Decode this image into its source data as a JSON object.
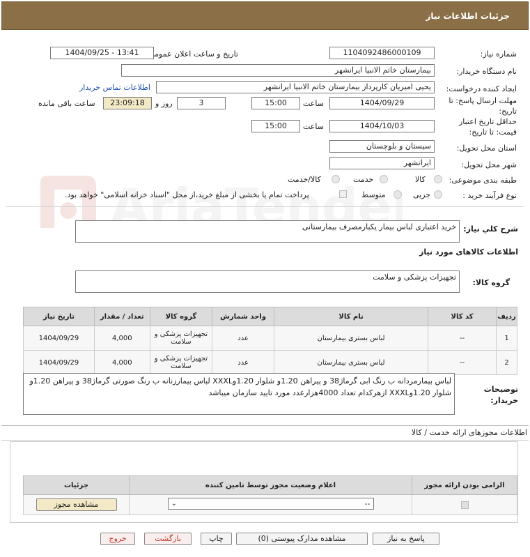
{
  "header": {
    "title": "جزئیات اطلاعات نیاز"
  },
  "fields": {
    "need_number_label": "شماره نیاز:",
    "need_number": "1104092486000109",
    "announce_label": "تاریخ و ساعت اعلان عمومی:",
    "announce_value": "1404/09/25 - 13:41",
    "buyer_label": "نام دستگاه خریدار:",
    "buyer_value": "بیمارستان خاتم الانبیا ایرانشهر",
    "creator_label": "ایجاد کننده درخواست:",
    "creator_value": "یحیی امیریان کارپرداز بیمارستان خاتم الانبیا ایرانشهر",
    "contact_link": "اطلاعات تماس خریدار",
    "deadline_label": "مهلت ارسال پاسخ: تا تاریخ:",
    "deadline_date": "1404/09/29",
    "time_label": "ساعت",
    "deadline_time": "15:00",
    "days_value": "3",
    "days_label": "روز و",
    "remaining_value": "23:09:18",
    "remaining_label": "ساعت باقی مانده",
    "validity_label": "حداقل تاریخ اعتبار قیمت: تا تاریخ:",
    "validity_date": "1404/10/03",
    "validity_time": "15:00",
    "province_label": "استان محل تحویل:",
    "province_value": "سیستان و بلوچستان",
    "city_label": "شهر محل تحویل:",
    "city_value": "ایرانشهر",
    "category_label": "طبقه بندی موضوعی:",
    "category_options": [
      "کالا",
      "خدمت",
      "کالا/خدمت"
    ],
    "process_label": "نوع فرآیند خرید :",
    "process_options": [
      "جزیی",
      "متوسط"
    ],
    "payment_note": "پرداخت تمام یا بخشی از مبلغ خرید،از محل \"اسناد خزانه اسلامی\" خواهد بود."
  },
  "summary": {
    "label": "شرح کلي نياز:",
    "value": "خرید اعتباری لباس بیمار یکبارمصرف بیمارستانی"
  },
  "goods_section_title": "اطلاعات کالاهای مورد نیاز",
  "goods_group": {
    "label": "گروه کالا:",
    "value": "تجهیزات پزشکی و سلامت"
  },
  "table": {
    "headers": [
      "ردیف",
      "کد کالا",
      "نام کالا",
      "واحد شمارش",
      "گروه کالا",
      "تعداد / مقدار",
      "تاریخ نیاز"
    ],
    "rows": [
      [
        "1",
        "--",
        "لباس بستری بیمارستان",
        "عدد",
        "تجهیزات پزشکی و سلامت",
        "4,000",
        "1404/09/29"
      ],
      [
        "2",
        "--",
        "لباس بستری بیمارستان",
        "عدد",
        "تجهیزات پزشکی و سلامت",
        "4,000",
        "1404/09/29"
      ]
    ]
  },
  "buyer_notes": {
    "label": "توضیحات خریدار:",
    "value": "لباس بیمارمردانه ب رنگ ابی گرماژ38 و پیراهن 1.20و شلوار 1.20وXXXL لباس بیمارزنانه ب رنگ صورتی  گرماژ38 و پیراهن 1.20و شلوار 1.20وXXXL ازهرکدام تعداد 4000هزارعدد مورد تایید سازمان میباشد"
  },
  "permits": {
    "title": "اطلاعات مجوزهای ارائه خدمت / کالا",
    "headers": [
      "الزامی بودن ارائه مجوز",
      "اعلام وضعیت مجوز توسط تامین کننده",
      "جزئیات"
    ],
    "select_value": "--",
    "view_button": "مشاهده مجوز"
  },
  "buttons": {
    "reply": "پاسخ به نیاز",
    "docs": "مشاهده مدارک پیوستی (0)",
    "print": "چاپ",
    "back": "بازگشت",
    "exit": "خروج"
  },
  "watermark": {
    "text": "AriaTender.neT"
  }
}
